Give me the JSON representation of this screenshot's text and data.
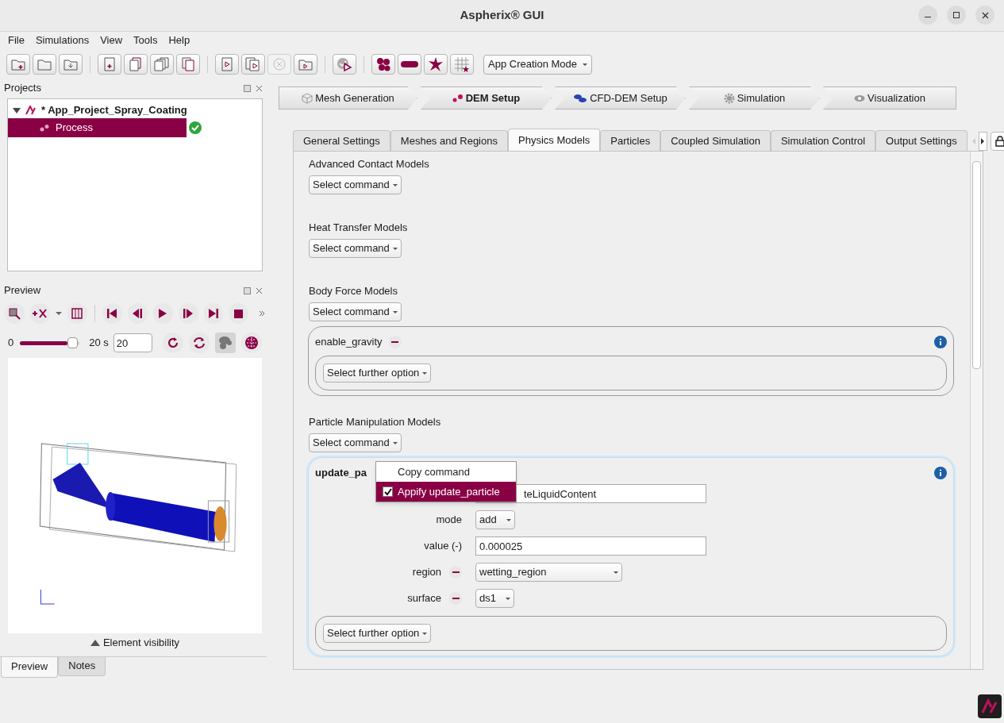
{
  "window": {
    "title": "Aspherix® GUI"
  },
  "menu": [
    "File",
    "Simulations",
    "View",
    "Tools",
    "Help"
  ],
  "toolbar": {
    "mode_select": "App Creation Mode"
  },
  "projects": {
    "title": "Projects",
    "tree": [
      {
        "label": "* App_Project_Spray_Coating",
        "expanded": true,
        "children": [
          {
            "label": "Process",
            "selected": true
          }
        ]
      }
    ]
  },
  "preview": {
    "title": "Preview",
    "slider_min": "0",
    "level": 0.97,
    "slider_max": "20 s",
    "frame": "20",
    "element_visibility": "Element visibility"
  },
  "bottom_tabs": [
    {
      "label": "Preview",
      "selected": true
    },
    {
      "label": "Notes",
      "selected": false
    }
  ],
  "workflow": [
    {
      "label": "Mesh Generation",
      "selected": false
    },
    {
      "label": "DEM Setup",
      "selected": true
    },
    {
      "label": "CFD-DEM Setup",
      "selected": false
    },
    {
      "label": "Simulation",
      "selected": false
    },
    {
      "label": "Visualization",
      "selected": false
    }
  ],
  "tabs": [
    {
      "label": "General Settings",
      "selected": false
    },
    {
      "label": "Meshes and Regions",
      "selected": false
    },
    {
      "label": "Physics Models",
      "selected": true
    },
    {
      "label": "Particles",
      "selected": false
    },
    {
      "label": "Coupled Simulation",
      "selected": false
    },
    {
      "label": "Simulation Control",
      "selected": false
    },
    {
      "label": "Output Settings",
      "selected": false
    }
  ],
  "sections": [
    {
      "title": "Advanced Contact Models",
      "command": "Select command"
    },
    {
      "title": "Heat Transfer Models",
      "command": "Select command"
    },
    {
      "title": "Body Force Models",
      "command": "Select command",
      "group": {
        "title": "enable_gravity",
        "highlighted": false,
        "further": "Select further option"
      }
    },
    {
      "title": "Particle Manipulation Models",
      "command": "Select command",
      "group": {
        "title": "update_pa",
        "highlighted": true,
        "further": "Select further option",
        "rows": [
          {
            "kind": "text",
            "label": "",
            "value": "teLiquidContent"
          },
          {
            "kind": "dropdown",
            "label": "mode",
            "removable": false,
            "value": "add"
          },
          {
            "kind": "text",
            "label": "value (-)",
            "removable": false,
            "value": "0.000025"
          },
          {
            "kind": "combobox",
            "label": "region",
            "removable": true,
            "value": "wetting_region"
          },
          {
            "kind": "dropdown",
            "label": "surface",
            "removable": true,
            "value": "ds1"
          }
        ]
      }
    }
  ],
  "context_menu": [
    {
      "label": "Copy command",
      "selected": false
    },
    {
      "label": "Appify update_particle",
      "checked": true,
      "selected": true
    }
  ]
}
